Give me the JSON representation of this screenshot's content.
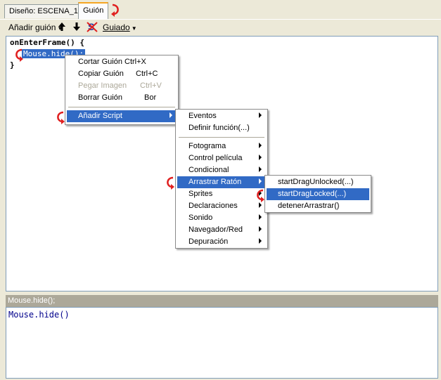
{
  "tabs": [
    {
      "label": "Diseño: ESCENA_1",
      "active": false
    },
    {
      "label": "Guión",
      "active": true
    }
  ],
  "toolbar": {
    "add_script_label": "Añadir guión",
    "move_up_icon": "arrow-up-icon",
    "move_down_icon": "arrow-down-icon",
    "syntax_icon": "syntax-check-icon",
    "guided_label": "Guiado"
  },
  "editor": {
    "line1": "onEnterFrame() {",
    "line2": "Mouse.hide();",
    "line3": "}"
  },
  "context_menu": {
    "items": [
      {
        "label": "Cortar Guión",
        "shortcut": "Ctrl+X"
      },
      {
        "label": "Copiar Guión",
        "shortcut": "Ctrl+C"
      },
      {
        "label": "Pegar Imagen",
        "shortcut": "Ctrl+V"
      },
      {
        "label": "Borrar Guión",
        "shortcut": "Bor"
      },
      {
        "label": "Añadir Script"
      }
    ]
  },
  "script_menu": {
    "items": [
      {
        "label": "Eventos"
      },
      {
        "label": "Definir función(...)"
      },
      {
        "label": "Fotograma"
      },
      {
        "label": "Control película"
      },
      {
        "label": "Condicional"
      },
      {
        "label": "Arrastrar Ratón"
      },
      {
        "label": "Sprites"
      },
      {
        "label": "Declaraciones"
      },
      {
        "label": "Sonido"
      },
      {
        "label": "Navegador/Red"
      },
      {
        "label": "Depuración"
      }
    ]
  },
  "drag_menu": {
    "items": [
      {
        "label": "startDragUnlocked(...)"
      },
      {
        "label": "startDragLocked(...)"
      },
      {
        "label": "detenerArrastrar()"
      }
    ]
  },
  "bottom": {
    "header": "Mouse.hide();",
    "code": "Mouse.hide()"
  },
  "colors": {
    "highlight": "#316ac5",
    "annotation_red": "#e02020",
    "tab_accent": "#f5a623"
  }
}
